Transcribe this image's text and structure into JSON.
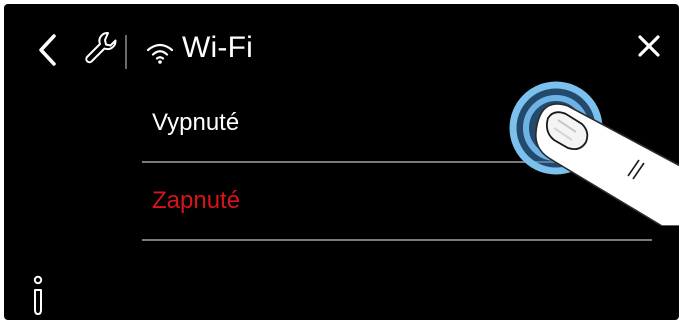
{
  "header": {
    "title": "Wi-Fi",
    "back_icon": "chevron-left-icon",
    "settings_icon": "wrench-icon",
    "wifi_icon": "wifi-icon",
    "close_icon": "close-icon"
  },
  "options": [
    {
      "label": "Vypnuté",
      "selected": false
    },
    {
      "label": "Zapnuté",
      "selected": true
    }
  ],
  "footer": {
    "info_icon": "info-icon"
  },
  "colors": {
    "background": "#000000",
    "text": "#ffffff",
    "selected": "#d8141b",
    "divider": "#7a7a7a",
    "touch_ring": "#6db3e6"
  }
}
